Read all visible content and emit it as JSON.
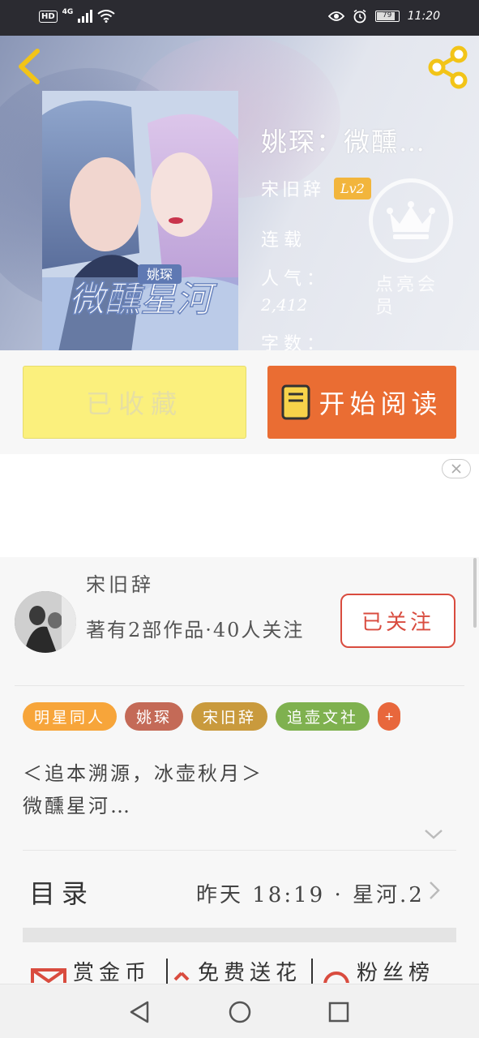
{
  "status_bar": {
    "hd": "HD",
    "network": "4G",
    "battery": "79",
    "time": "11:20"
  },
  "book": {
    "title": "姚琛：微醺…",
    "author": "宋旧辞",
    "level": "Lv2",
    "status": "连载",
    "popularity_label": "人气：",
    "popularity_value": "2,412",
    "words_label": "字数："
  },
  "vip": {
    "label": "点亮会员"
  },
  "cover": {
    "title": "微醺星河",
    "badge": "姚琛"
  },
  "actions": {
    "collect_label": "已收藏",
    "read_label": "开始阅读"
  },
  "author_section": {
    "name": "宋旧辞",
    "info": "著有2部作品·40人关注",
    "follow_label": "已关注"
  },
  "tags": [
    {
      "label": "明星同人",
      "color": "#f7a53a"
    },
    {
      "label": "姚琛",
      "color": "#c46a57"
    },
    {
      "label": "宋旧辞",
      "color": "#c99a3d"
    },
    {
      "label": "追壶文社",
      "color": "#7fb14f"
    },
    {
      "label": "+",
      "color": "#e8673c"
    }
  ],
  "description": "＜追本溯源，冰壶秋月＞\n微醺星河…",
  "toc": {
    "title": "目录",
    "latest": "昨天 18:19 · 星河.2"
  },
  "support": {
    "reward": "赏金币",
    "flowers": "免费送花",
    "fans": "粉丝榜"
  },
  "colors": {
    "accent_orange": "#ea6d33",
    "collect_yellow": "#fbf07d",
    "follow_red": "#d94c3f",
    "level_gold": "#f2b53c"
  }
}
